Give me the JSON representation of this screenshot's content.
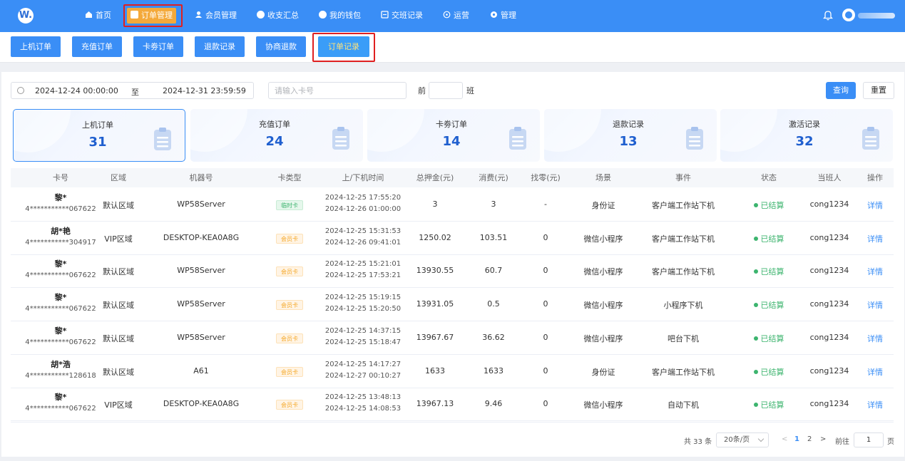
{
  "nav": {
    "logo": "W.",
    "items": [
      {
        "label": "首页",
        "icon": "home-icon"
      },
      {
        "label": "订单管理",
        "icon": "order-icon"
      },
      {
        "label": "会员管理",
        "icon": "member-icon"
      },
      {
        "label": "收支汇总",
        "icon": "pie-icon"
      },
      {
        "label": "我的钱包",
        "icon": "wallet-icon"
      },
      {
        "label": "交班记录",
        "icon": "shift-icon"
      },
      {
        "label": "运营",
        "icon": "operation-icon"
      },
      {
        "label": "管理",
        "icon": "gear-icon"
      }
    ],
    "active_color": "#f4a93a",
    "bar_color": "#3a8ef6"
  },
  "subtabs": [
    "上机订单",
    "充值订单",
    "卡劵订单",
    "退款记录",
    "协商退款",
    "订单记录"
  ],
  "filter": {
    "start": "2024-12-24 00:00:00",
    "to": "至",
    "end": "2024-12-31 23:59:59",
    "card_placeholder": "请输入卡号",
    "shift_prefix": "前",
    "shift_suffix": "班",
    "query": "查询",
    "reset": "重置"
  },
  "stats": [
    {
      "label": "上机订单",
      "value": "31"
    },
    {
      "label": "充值订单",
      "value": "24"
    },
    {
      "label": "卡劵订单",
      "value": "14"
    },
    {
      "label": "退款记录",
      "value": "13"
    },
    {
      "label": "激活记录",
      "value": "32"
    }
  ],
  "table": {
    "headers": [
      "卡号",
      "区域",
      "机器号",
      "卡类型",
      "上/下机时间",
      "总押金(元)",
      "消费(元)",
      "找零(元)",
      "场景",
      "事件",
      "状态",
      "当班人",
      "操作"
    ],
    "rows": [
      {
        "name": "黎*",
        "card": "4***********067622",
        "area": "默认区域",
        "machine": "WP58Server",
        "type": "临时卡",
        "type_kind": "temp",
        "t1": "2024-12-25 17:55:20",
        "t2": "2024-12-26 01:00:00",
        "deposit": "3",
        "spend": "3",
        "change": "-",
        "scene": "身份证",
        "event": "客户端工作站下机",
        "status": "已结算",
        "staff": "cong1234",
        "action": "详情"
      },
      {
        "name": "胡*艳",
        "card": "4***********304917",
        "area": "VIP区域",
        "machine": "DESKTOP-KEA0A8G",
        "type": "会员卡",
        "type_kind": "member",
        "t1": "2024-12-25 15:31:53",
        "t2": "2024-12-26 09:41:01",
        "deposit": "1250.02",
        "spend": "103.51",
        "change": "0",
        "scene": "微信小程序",
        "event": "客户端工作站下机",
        "status": "已结算",
        "staff": "cong1234",
        "action": "详情"
      },
      {
        "name": "黎*",
        "card": "4***********067622",
        "area": "默认区域",
        "machine": "WP58Server",
        "type": "会员卡",
        "type_kind": "member",
        "t1": "2024-12-25 15:21:01",
        "t2": "2024-12-25 17:53:21",
        "deposit": "13930.55",
        "spend": "60.7",
        "change": "0",
        "scene": "微信小程序",
        "event": "客户端工作站下机",
        "status": "已结算",
        "staff": "cong1234",
        "action": "详情"
      },
      {
        "name": "黎*",
        "card": "4***********067622",
        "area": "默认区域",
        "machine": "WP58Server",
        "type": "会员卡",
        "type_kind": "member",
        "t1": "2024-12-25 15:19:15",
        "t2": "2024-12-25 15:20:50",
        "deposit": "13931.05",
        "spend": "0.5",
        "change": "0",
        "scene": "微信小程序",
        "event": "小程序下机",
        "status": "已结算",
        "staff": "cong1234",
        "action": "详情"
      },
      {
        "name": "黎*",
        "card": "4***********067622",
        "area": "默认区域",
        "machine": "WP58Server",
        "type": "会员卡",
        "type_kind": "member",
        "t1": "2024-12-25 14:37:15",
        "t2": "2024-12-25 15:18:47",
        "deposit": "13967.67",
        "spend": "36.62",
        "change": "0",
        "scene": "微信小程序",
        "event": "吧台下机",
        "status": "已结算",
        "staff": "cong1234",
        "action": "详情"
      },
      {
        "name": "胡*浩",
        "card": "4***********128618",
        "area": "默认区域",
        "machine": "A61",
        "type": "会员卡",
        "type_kind": "member",
        "t1": "2024-12-25 14:17:27",
        "t2": "2024-12-27 00:10:27",
        "deposit": "1633",
        "spend": "1633",
        "change": "0",
        "scene": "身份证",
        "event": "客户端工作站下机",
        "status": "已结算",
        "staff": "cong1234",
        "action": "详情"
      },
      {
        "name": "黎*",
        "card": "4***********067622",
        "area": "VIP区域",
        "machine": "DESKTOP-KEA0A8G",
        "type": "会员卡",
        "type_kind": "member",
        "t1": "2024-12-25 13:48:13",
        "t2": "2024-12-25 14:08:53",
        "deposit": "13967.13",
        "spend": "9.46",
        "change": "0",
        "scene": "微信小程序",
        "event": "自动下机",
        "status": "已结算",
        "staff": "cong1234",
        "action": "详情"
      }
    ]
  },
  "pagination": {
    "total": "共 33 条",
    "page_size": "20条/页",
    "prev": "<",
    "pages": [
      "1",
      "2"
    ],
    "next": ">",
    "goto_label": "前往",
    "goto_value": "1",
    "goto_suffix": "页"
  }
}
